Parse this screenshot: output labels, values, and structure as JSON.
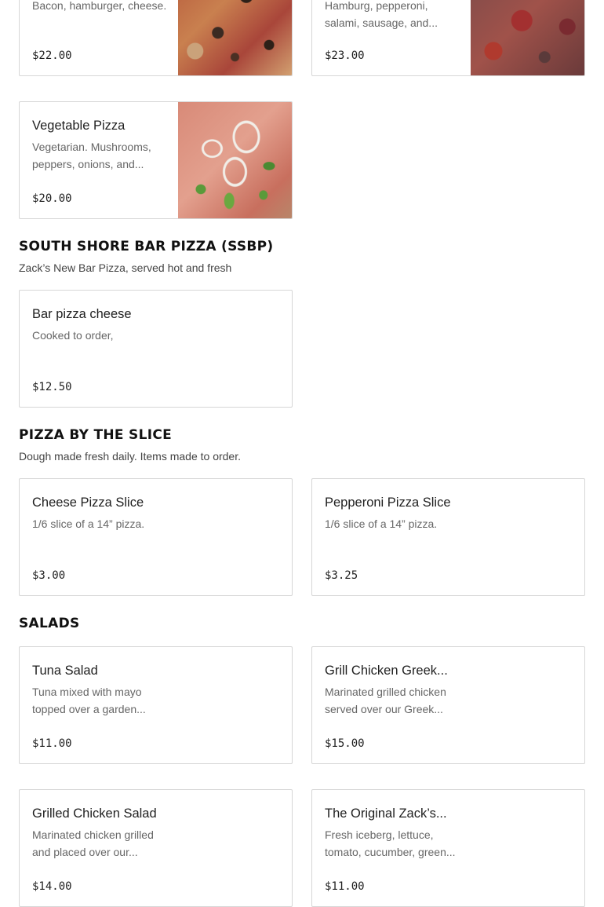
{
  "top_cards": [
    {
      "desc": "Bacon, hamburger, cheese.",
      "price": "$22.00",
      "photo": "bacon-hamburger-pizza-photo"
    },
    {
      "desc": "Hamburg, pepperoni, salami, sausage, and...",
      "price": "$23.00",
      "photo": "meat-lovers-pizza-photo"
    }
  ],
  "vegetable_card": {
    "name": "Vegetable Pizza",
    "desc": "Vegetarian. Mushrooms, peppers, onions, and...",
    "price": "$20.00",
    "photo": "vegetable-pizza-photo"
  },
  "sections": {
    "ssbp": {
      "title": "SOUTH SHORE BAR PIZZA (SSBP)",
      "description": "Zack’s New Bar Pizza, served hot and fresh",
      "items": [
        {
          "name": "Bar pizza cheese",
          "desc": "Cooked to order,",
          "price": "$12.50"
        }
      ]
    },
    "slice": {
      "title": "PIZZA BY THE SLICE",
      "description": "Dough made fresh daily. Items made to order.",
      "items": [
        {
          "name": "Cheese Pizza Slice",
          "desc": "1/6 slice of a 14” pizza.",
          "price": "$3.00"
        },
        {
          "name": "Pepperoni Pizza Slice",
          "desc": "1/6 slice of a 14” pizza.",
          "price": "$3.25"
        }
      ]
    },
    "salads": {
      "title": "SALADS",
      "items": [
        {
          "name": "Tuna Salad",
          "desc": "Tuna mixed with mayo topped over a garden...",
          "price": "$11.00"
        },
        {
          "name": "Grill Chicken Greek...",
          "desc": "Marinated grilled chicken served over our Greek...",
          "price": "$15.00"
        },
        {
          "name": "Grilled Chicken Salad",
          "desc": "Marinated chicken grilled and placed over our...",
          "price": "$14.00"
        },
        {
          "name": "The Original Zack’s...",
          "desc": "Fresh iceberg, lettuce, tomato, cucumber, green...",
          "price": "$11.00"
        }
      ]
    }
  }
}
